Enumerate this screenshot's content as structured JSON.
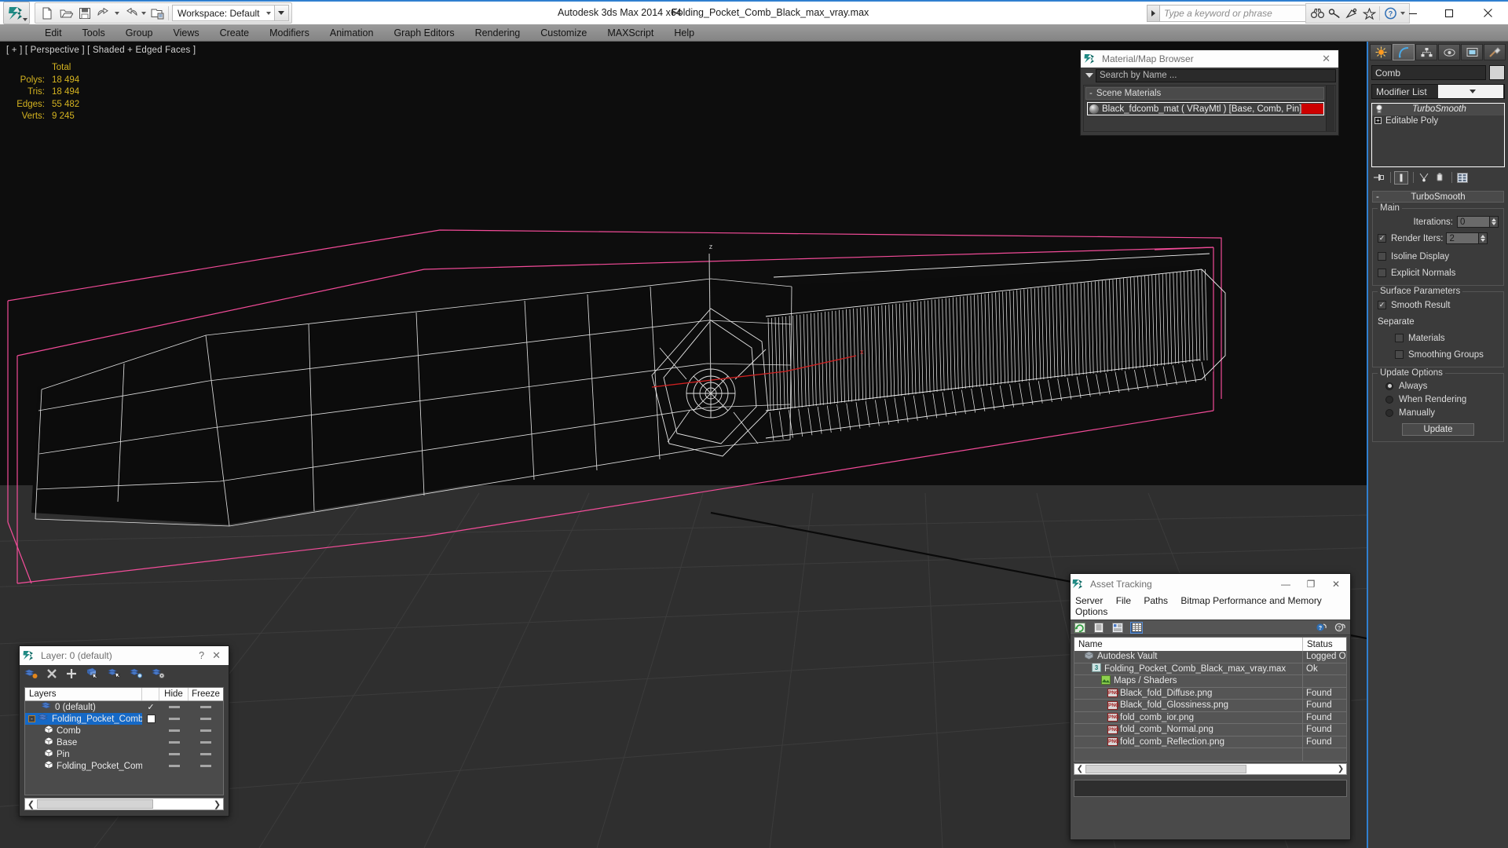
{
  "titlebar": {
    "app_title": "Autodesk 3ds Max  2014 x64",
    "file_title": "Folding_Pocket_Comb_Black_max_vray.max",
    "workspace_label": "Workspace: Default",
    "search_placeholder": "Type a keyword or phrase",
    "quick_access": [
      "new-icon",
      "open-icon",
      "save-icon",
      "undo-icon",
      "redo-icon",
      "set-project-icon"
    ],
    "help_icons": [
      "binoculars-icon",
      "key-icon",
      "satellite-icon",
      "star-icon",
      "help-icon"
    ],
    "window_controls": [
      "minimize",
      "maximize",
      "close"
    ]
  },
  "menubar": {
    "items": [
      "Edit",
      "Tools",
      "Group",
      "Views",
      "Create",
      "Modifiers",
      "Animation",
      "Graph Editors",
      "Rendering",
      "Customize",
      "MAXScript",
      "Help"
    ]
  },
  "viewport": {
    "label": "[ + ] [ Perspective ] [ Shaded + Edged Faces ]",
    "stats_header": "Total",
    "stats": [
      {
        "label": "Polys:",
        "value": "18 494"
      },
      {
        "label": "Tris:",
        "value": "18 494"
      },
      {
        "label": "Edges:",
        "value": "55 482"
      },
      {
        "label": "Verts:",
        "value": "9 245"
      }
    ],
    "axis_labels": {
      "z": "z",
      "x": "x"
    }
  },
  "material_browser": {
    "title": "Material/Map Browser",
    "search_placeholder": "Search by Name ...",
    "scene_materials_label": "Scene Materials",
    "material": {
      "name": "Black_fdcomb_mat  ( VRayMtl )  [Base, Comb, Pin]",
      "swatch_color": "#cc0000"
    }
  },
  "command_panel": {
    "tabs": [
      "create-tab",
      "modify-tab",
      "hierarchy-tab",
      "motion-tab",
      "display-tab",
      "utilities-tab"
    ],
    "active_tab_index": 1,
    "object_name": "Comb",
    "object_color": "#d4d4d4",
    "modifier_list_label": "Modifier List",
    "stack": [
      {
        "label": "TurboSmooth",
        "active": true
      },
      {
        "label": "Editable Poly",
        "active": false
      }
    ],
    "rollout": {
      "title": "TurboSmooth",
      "main_group": "Main",
      "iterations_label": "Iterations:",
      "iterations_value": "0",
      "render_iters_label": "Render Iters:",
      "render_iters_value": "2",
      "render_iters_checked": true,
      "isoline_display_label": "Isoline Display",
      "isoline_display_checked": false,
      "explicit_normals_label": "Explicit Normals",
      "explicit_normals_checked": false,
      "surface_group": "Surface Parameters",
      "smooth_result_label": "Smooth Result",
      "smooth_result_checked": true,
      "separate_label": "Separate",
      "materials_label": "Materials",
      "materials_checked": false,
      "smoothing_groups_label": "Smoothing Groups",
      "smoothing_groups_checked": false,
      "update_group": "Update Options",
      "update_options": [
        {
          "label": "Always",
          "selected": true
        },
        {
          "label": "When Rendering",
          "selected": false
        },
        {
          "label": "Manually",
          "selected": false
        }
      ],
      "update_button": "Update"
    }
  },
  "layer_dialog": {
    "title": "Layer: 0 (default)",
    "help_glyph": "?",
    "close_glyph": "✕",
    "toolbar": [
      "create-new-layer-icon",
      "delete-layer-icon",
      "add-to-layer-icon",
      "select-objects-in-layer-icon",
      "select-highlighted-objects-icon",
      "highlight-selected-objects-icon",
      "layer-properties-icon"
    ],
    "columns": {
      "name": "Layers",
      "hide": "Hide",
      "freeze": "Freeze"
    },
    "rows": [
      {
        "label": "0 (default)",
        "indent": 0,
        "type": "layer",
        "current": true,
        "selected": false,
        "hide_checkbox": false
      },
      {
        "label": "Folding_Pocket_Comb_Black",
        "indent": 0,
        "type": "layer",
        "current": false,
        "selected": true,
        "hide_checkbox": true,
        "expander": "minus"
      },
      {
        "label": "Comb",
        "indent": 1,
        "type": "object",
        "selected": false
      },
      {
        "label": "Base",
        "indent": 1,
        "type": "object",
        "selected": false
      },
      {
        "label": "Pin",
        "indent": 1,
        "type": "object",
        "selected": false
      },
      {
        "label": "Folding_Pocket_Comb_Black",
        "indent": 1,
        "type": "object",
        "selected": false
      }
    ]
  },
  "asset_tracking": {
    "title": "Asset Tracking",
    "window_controls": [
      "—",
      "❐",
      "✕"
    ],
    "menu": [
      "Server",
      "File",
      "Paths",
      "Bitmap Performance and Memory",
      "Options"
    ],
    "toolbar": [
      "refresh-icon",
      "list-view-icon",
      "details-view-icon",
      "grid-view-icon"
    ],
    "toolbar_selected_index": 3,
    "help_icons": [
      "help-blue-icon",
      "help-white-icon"
    ],
    "columns": {
      "name": "Name",
      "status": "Status"
    },
    "rows": [
      {
        "name": "Autodesk Vault",
        "status": "Logged O",
        "indent": 0,
        "icon": "vault-icon"
      },
      {
        "name": "Folding_Pocket_Comb_Black_max_vray.max",
        "status": "Ok",
        "indent": 1,
        "icon": "max-file-icon"
      },
      {
        "name": "Maps / Shaders",
        "status": "",
        "indent": 2,
        "icon": "maps-icon"
      },
      {
        "name": "Black_fold_Diffuse.png",
        "status": "Found",
        "indent": 3,
        "icon": "png-icon"
      },
      {
        "name": "Black_fold_Glossiness.png",
        "status": "Found",
        "indent": 3,
        "icon": "png-icon"
      },
      {
        "name": "fold_comb_ior.png",
        "status": "Found",
        "indent": 3,
        "icon": "png-icon"
      },
      {
        "name": "fold_comb_Normal.png",
        "status": "Found",
        "indent": 3,
        "icon": "png-icon"
      },
      {
        "name": "fold_comb_Reflection.png",
        "status": "Found",
        "indent": 3,
        "icon": "png-icon"
      }
    ]
  }
}
